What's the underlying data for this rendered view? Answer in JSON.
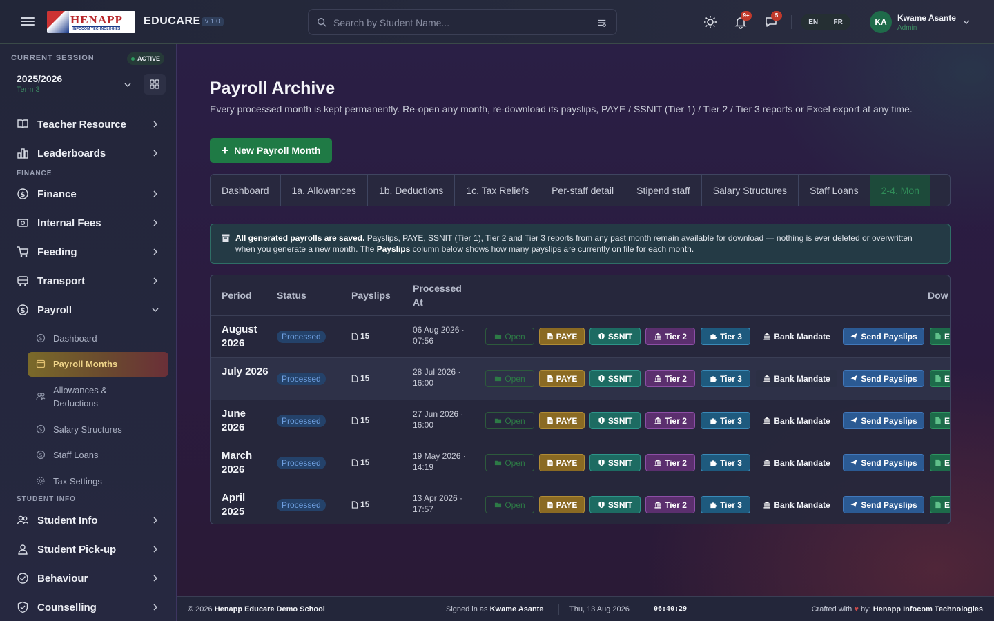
{
  "topbar": {
    "logo_text": "HENAPP",
    "logo_subtext": "INFOCOM TECHNOLOGIES",
    "brand": "EDUCARE",
    "version": "v 1.0",
    "search_placeholder": "Search by Student Name...",
    "notifications_badge": "9+",
    "messages_badge": "5",
    "lang_en": "EN",
    "lang_fr": "FR",
    "user_initials": "KA",
    "user_name": "Kwame Asante",
    "user_role": "Admin"
  },
  "sidebar": {
    "session_label": "CURRENT SESSION",
    "session_status": "ACTIVE",
    "session_year": "2025/2026",
    "session_term": "Term 3",
    "items": [
      {
        "label": "Teacher Resource",
        "icon": "book-icon"
      },
      {
        "label": "Leaderboards",
        "icon": "bar-chart-icon"
      }
    ],
    "section_finance": "FINANCE",
    "finance_items": [
      {
        "label": "Finance",
        "icon": "dollar-circle-icon"
      },
      {
        "label": "Internal Fees",
        "icon": "cash-icon"
      },
      {
        "label": "Feeding",
        "icon": "cart-icon"
      },
      {
        "label": "Transport",
        "icon": "bus-icon"
      },
      {
        "label": "Payroll",
        "icon": "dollar-circle-icon"
      }
    ],
    "payroll_sub": [
      {
        "label": "Dashboard"
      },
      {
        "label": "Payroll Months"
      },
      {
        "label": "Allowances & Deductions"
      },
      {
        "label": "Salary Structures"
      },
      {
        "label": "Staff Loans"
      },
      {
        "label": "Tax Settings"
      }
    ],
    "section_student": "STUDENT INFO",
    "student_items": [
      {
        "label": "Student Info",
        "icon": "users-icon"
      },
      {
        "label": "Student Pick-up",
        "icon": "user-icon"
      },
      {
        "label": "Behaviour",
        "icon": "check-circle-icon"
      },
      {
        "label": "Counselling",
        "icon": "shield-icon"
      }
    ]
  },
  "main": {
    "title": "Payroll Archive",
    "description": "Every processed month is kept permanently. Re-open any month, re-download its payslips, PAYE / SSNIT (Tier 1) / Tier 2 / Tier 3 reports or Excel export at any time.",
    "new_button": "New Payroll Month",
    "tabs": [
      "Dashboard",
      "1a. Allowances",
      "1b. Deductions",
      "1c. Tax Reliefs",
      "Per-staff detail",
      "Stipend staff",
      "Salary Structures",
      "Staff Loans",
      "2-4. Mon"
    ],
    "info_bold": "All generated payrolls are saved.",
    "info_part1": " Payslips, PAYE, SSNIT (Tier 1), Tier 2 and Tier 3 reports from any past month remain available for download — nothing is ever deleted or overwritten when you generate a new month. The ",
    "info_bold2": "Payslips",
    "info_part2": " column below shows how many payslips are currently on file for each month.",
    "table": {
      "headers": {
        "period": "Period",
        "status": "Status",
        "payslips": "Payslips",
        "processed_at": "Processed At",
        "downloads": "Dow"
      },
      "actions": {
        "open": "Open",
        "paye": "PAYE",
        "ssnit": "SSNIT",
        "tier2": "Tier 2",
        "tier3": "Tier 3",
        "bank": "Bank Mandate",
        "send": "Send Payslips",
        "excel": "E"
      },
      "rows": [
        {
          "period": "August 2026",
          "status": "Processed",
          "payslips": "15",
          "processed_at": "06 Aug 2026 · 07:56"
        },
        {
          "period": "July 2026",
          "status": "Processed",
          "payslips": "15",
          "processed_at": "28 Jul 2026 · 16:00"
        },
        {
          "period": "June 2026",
          "status": "Processed",
          "payslips": "15",
          "processed_at": "27 Jun 2026 · 16:00"
        },
        {
          "period": "March 2026",
          "status": "Processed",
          "payslips": "15",
          "processed_at": "19 May 2026 · 14:19"
        },
        {
          "period": "April 2025",
          "status": "Processed",
          "payslips": "15",
          "processed_at": "13 Apr 2026 · 17:57"
        }
      ]
    }
  },
  "footer": {
    "copyright_prefix": "© 2026 ",
    "school": "Henapp Educare Demo School",
    "signed_prefix": "Signed in as ",
    "signed_user": "Kwame Asante",
    "date": "Thu, 13 Aug 2026",
    "time": "06:40:29",
    "crafted_prefix": "Crafted with ",
    "crafted_mid": " by: ",
    "crafted_company": "Henapp Infocom Technologies"
  },
  "colors": {
    "accent_green": "#1f7a45",
    "paye": "#8a6a23",
    "ssnit": "#1d6b62",
    "tier2": "#5b2f6e",
    "tier3": "#1e5a7e",
    "send": "#2b5a93",
    "active_sub": "#f0d58a"
  }
}
